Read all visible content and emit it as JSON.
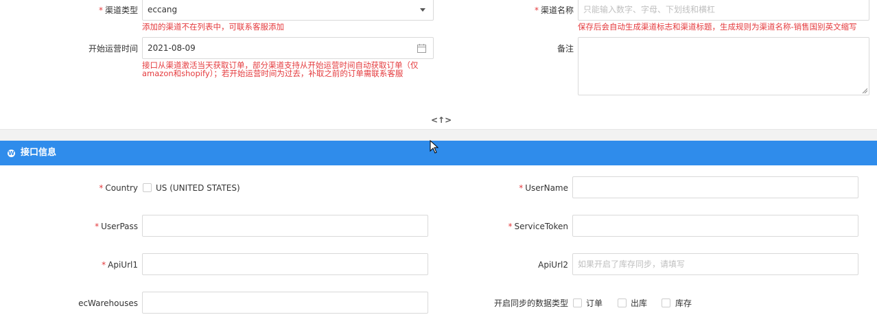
{
  "channel_form": {
    "channel_type": {
      "label": "渠道类型",
      "value": "eccang",
      "hint": "添加的渠道不在列表中，可联系客服添加"
    },
    "channel_name": {
      "label": "渠道名称",
      "placeholder": "只能输入数字、字母、下划线和横杠",
      "hint": "保存后会自动生成渠道标志和渠道标题，生成规则为渠道名称-销售国别英文缩写"
    },
    "start_date": {
      "label": "开始运营时间",
      "value": "2021-08-09",
      "hint_line1": "接口从渠道激活当天获取订单，部分渠道支持从开始运营时间自动获取订单（仅",
      "hint_line2": "amazon和shopify）；若开始运营时间为过去，补取之前的订单需联系客服"
    },
    "remark": {
      "label": "备注"
    }
  },
  "collapse_toggle": "<↑>",
  "section": {
    "title": "接口信息"
  },
  "interface_form": {
    "country": {
      "label": "Country",
      "option": "US (UNITED STATES)"
    },
    "username": {
      "label": "UserName"
    },
    "userpass": {
      "label": "UserPass"
    },
    "service_token": {
      "label": "ServiceToken"
    },
    "apiurl1": {
      "label": "ApiUrl1"
    },
    "apiurl2": {
      "label": "ApiUrl2",
      "placeholder": "如果开启了库存同步，请填写"
    },
    "ec_warehouses": {
      "label": "ecWarehouses"
    },
    "sync_types": {
      "label": "开启同步的数据类型",
      "options": [
        "订单",
        "出库",
        "库存"
      ]
    }
  },
  "required_mark": "*",
  "colors": {
    "accent": "#2f8ceb",
    "error": "#e4393c",
    "border": "#d9d9d9"
  }
}
